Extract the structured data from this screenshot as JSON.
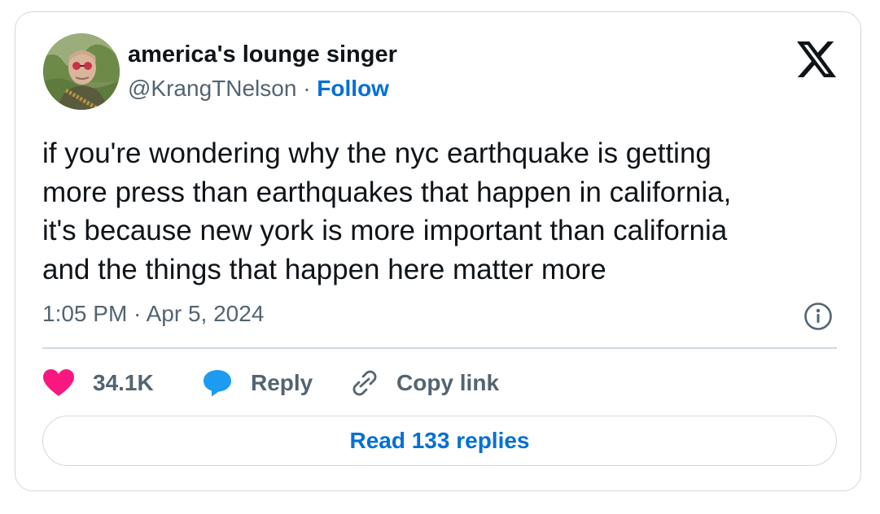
{
  "author": {
    "name": "america's lounge singer",
    "handle": "@KrangTNelson",
    "separator": "·",
    "follow_label": "Follow"
  },
  "tweet": {
    "text": "if you're wondering why the nyc earthquake is getting\nmore press than earthquakes that happen in california,\nit's because new york is more important than california\nand the things that happen here matter more",
    "timestamp": "1:05 PM · Apr 5, 2024"
  },
  "actions": {
    "like_count": "34.1K",
    "reply_label": "Reply",
    "copy_link_label": "Copy link"
  },
  "read_replies_label": "Read 133 replies",
  "icons": {
    "like": "heart-icon",
    "reply": "reply-bubble-icon",
    "copy": "link-icon",
    "brand": "x-logo-icon",
    "info": "info-icon"
  },
  "colors": {
    "like": "#f91880",
    "reply": "#1d9bf0",
    "link": "#006fd6",
    "muted": "#536471",
    "border": "#cfd9de",
    "text": "#0f1419"
  }
}
